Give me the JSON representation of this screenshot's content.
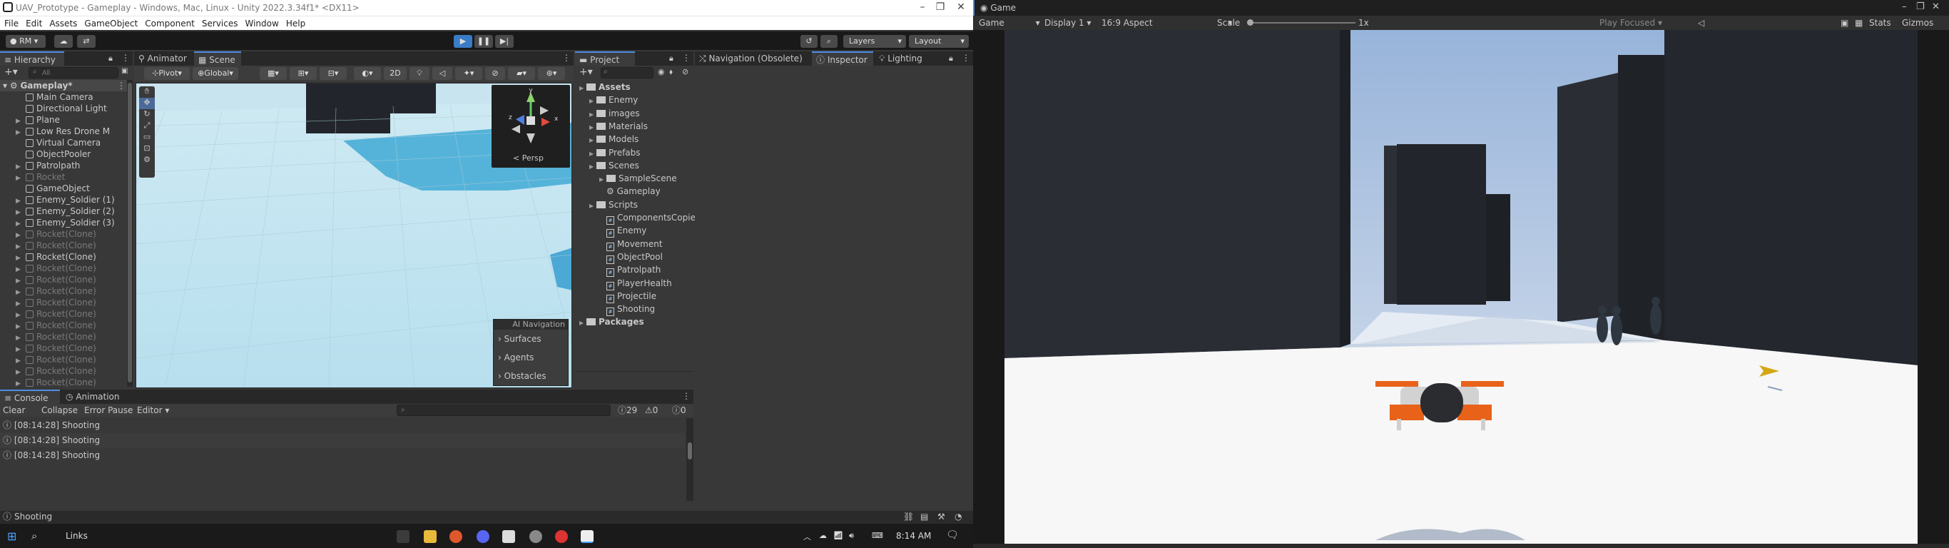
{
  "titlebar": {
    "title": "UAV_Prototype - Gameplay - Windows, Mac, Linux - Unity 2022.3.34f1* <DX11>"
  },
  "menu": [
    "File",
    "Edit",
    "Assets",
    "GameObject",
    "Component",
    "Services",
    "Window",
    "Help"
  ],
  "toolbar": {
    "account": "RM",
    "layers": "Layers",
    "layout": "Layout"
  },
  "hierarchy": {
    "tab": "Hierarchy",
    "search_placeholder": "All",
    "scene": "Gameplay*",
    "items": [
      {
        "label": "Main Camera",
        "inactive": false,
        "arrow": false
      },
      {
        "label": "Directional Light",
        "inactive": false,
        "arrow": false
      },
      {
        "label": "Plane",
        "inactive": false,
        "arrow": true
      },
      {
        "label": "Low Res Drone M",
        "inactive": false,
        "arrow": true
      },
      {
        "label": "Virtual Camera",
        "inactive": false,
        "arrow": false
      },
      {
        "label": "ObjectPooler",
        "inactive": false,
        "arrow": false
      },
      {
        "label": "Patrolpath",
        "inactive": false,
        "arrow": true
      },
      {
        "label": "Rocket",
        "inactive": true,
        "arrow": true
      },
      {
        "label": "GameObject",
        "inactive": false,
        "arrow": false
      },
      {
        "label": "Enemy_Soldier (1)",
        "inactive": false,
        "arrow": true
      },
      {
        "label": "Enemy_Soldier (2)",
        "inactive": false,
        "arrow": true
      },
      {
        "label": "Enemy_Soldier (3)",
        "inactive": false,
        "arrow": true
      },
      {
        "label": "Rocket(Clone)",
        "inactive": true,
        "arrow": true
      },
      {
        "label": "Rocket(Clone)",
        "inactive": true,
        "arrow": true
      },
      {
        "label": "Rocket(Clone)",
        "inactive": false,
        "arrow": true
      },
      {
        "label": "Rocket(Clone)",
        "inactive": true,
        "arrow": true
      },
      {
        "label": "Rocket(Clone)",
        "inactive": true,
        "arrow": true
      },
      {
        "label": "Rocket(Clone)",
        "inactive": true,
        "arrow": true
      },
      {
        "label": "Rocket(Clone)",
        "inactive": true,
        "arrow": true
      },
      {
        "label": "Rocket(Clone)",
        "inactive": true,
        "arrow": true
      },
      {
        "label": "Rocket(Clone)",
        "inactive": true,
        "arrow": true
      },
      {
        "label": "Rocket(Clone)",
        "inactive": true,
        "arrow": true
      },
      {
        "label": "Rocket(Clone)",
        "inactive": true,
        "arrow": true
      },
      {
        "label": "Rocket(Clone)",
        "inactive": true,
        "arrow": true
      },
      {
        "label": "Rocket(Clone)",
        "inactive": true,
        "arrow": true
      },
      {
        "label": "Rocket(Clone)",
        "inactive": true,
        "arrow": true
      }
    ]
  },
  "scene_view": {
    "tabs": [
      "Animator",
      "Scene"
    ],
    "pivot": "Pivot",
    "global": "Global",
    "mode_2d": "2D",
    "persp": "< Persp",
    "ai_nav": {
      "title": "AI Navigation",
      "items": [
        "Surfaces",
        "Agents",
        "Obstacles"
      ]
    }
  },
  "project": {
    "tab": "Project",
    "tree": [
      {
        "label": "Assets",
        "depth": 0,
        "type": "folder",
        "bold": true
      },
      {
        "label": "Enemy",
        "depth": 1,
        "type": "folder"
      },
      {
        "label": "images",
        "depth": 1,
        "type": "folder"
      },
      {
        "label": "Materials",
        "depth": 1,
        "type": "folder"
      },
      {
        "label": "Models",
        "depth": 1,
        "type": "folder"
      },
      {
        "label": "Prefabs",
        "depth": 1,
        "type": "folder"
      },
      {
        "label": "Scenes",
        "depth": 1,
        "type": "folder"
      },
      {
        "label": "SampleScene",
        "depth": 2,
        "type": "folder"
      },
      {
        "label": "Gameplay",
        "depth": 2,
        "type": "scene"
      },
      {
        "label": "Scripts",
        "depth": 1,
        "type": "folder"
      },
      {
        "label": "ComponentsCopie",
        "depth": 2,
        "type": "script"
      },
      {
        "label": "Enemy",
        "depth": 2,
        "type": "script"
      },
      {
        "label": "Movement",
        "depth": 2,
        "type": "script"
      },
      {
        "label": "ObjectPool",
        "depth": 2,
        "type": "script"
      },
      {
        "label": "Patrolpath",
        "depth": 2,
        "type": "script"
      },
      {
        "label": "PlayerHealth",
        "depth": 2,
        "type": "script"
      },
      {
        "label": "Projectile",
        "depth": 2,
        "type": "script"
      },
      {
        "label": "Shooting",
        "depth": 2,
        "type": "script"
      },
      {
        "label": "Packages",
        "depth": 0,
        "type": "folder",
        "bold": true
      }
    ]
  },
  "inspector_tabs": [
    "Navigation (Obsolete)",
    "Inspector",
    "Lighting"
  ],
  "console": {
    "tabs": [
      "Console",
      "Animation"
    ],
    "buttons": [
      "Clear",
      "Collapse",
      "Error Pause",
      "Editor"
    ],
    "counts": {
      "log": "29",
      "warn": "0",
      "error": "0"
    },
    "logs": [
      "[08:14:28] Shooting",
      "[08:14:28] Shooting",
      "[08:14:28] Shooting"
    ]
  },
  "statusbar": {
    "message": "Shooting"
  },
  "game": {
    "tab": "Game",
    "display_mode": "Game",
    "display": "Display 1",
    "aspect": "16:9 Aspect",
    "scale_label": "Scale",
    "scale_value": "1x",
    "play_focused": "Play Focused",
    "stats": "Stats",
    "gizmos": "Gizmos"
  },
  "taskbar": {
    "links": "Links",
    "time": "8:14 AM"
  },
  "colors": {
    "accent": "#3a7cc6",
    "drone_orange": "#e8621a",
    "sky": "#c9d8ea",
    "ground": "#f6f6f6",
    "wall": "#23262c",
    "scene_floor": "#bfe4f0"
  }
}
